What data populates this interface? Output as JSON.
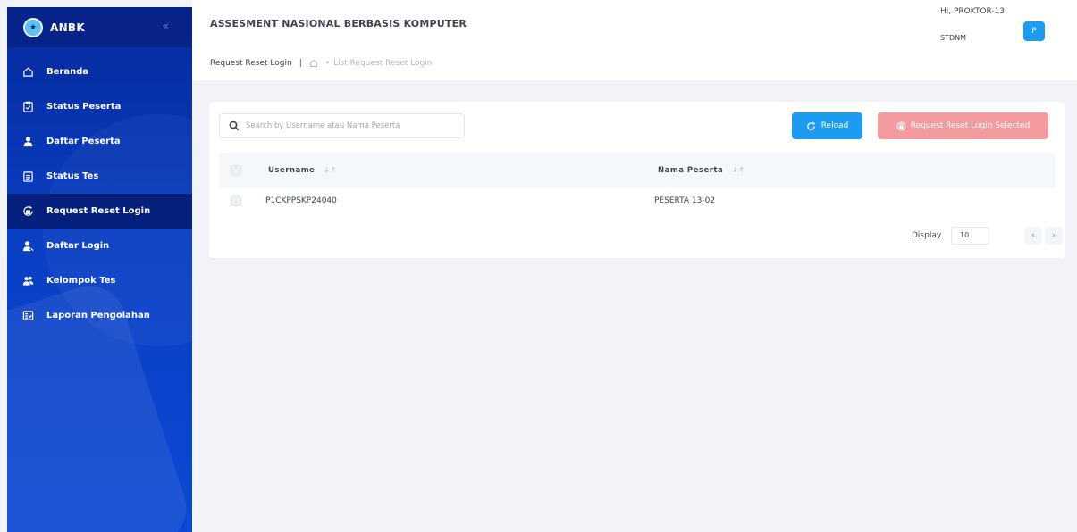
{
  "brand": {
    "name": "ANBK",
    "collapse_icon": "chevrons-left-icon"
  },
  "sidebar": {
    "items": [
      {
        "label": "Beranda",
        "icon": "home-icon",
        "active": false
      },
      {
        "label": "Status Peserta",
        "icon": "clipboard-check-icon",
        "active": false
      },
      {
        "label": "Daftar Peserta",
        "icon": "user-icon",
        "active": false
      },
      {
        "label": "Status Tes",
        "icon": "clipboard-list-icon",
        "active": false
      },
      {
        "label": "Request Reset Login",
        "icon": "reset-lock-icon",
        "active": true
      },
      {
        "label": "Daftar Login",
        "icon": "user-login-icon",
        "active": false
      },
      {
        "label": "Kelompok Tes",
        "icon": "users-group-icon",
        "active": false
      },
      {
        "label": "Laporan Pengolahan",
        "icon": "report-icon",
        "active": false
      }
    ]
  },
  "header": {
    "title": "ASSESMENT NASIONAL BERBASIS KOMPUTER",
    "greeting": "Hi, PROKTOR-13",
    "school": "STDNM",
    "avatar_initial": "P"
  },
  "breadcrumb": {
    "page": "Request Reset Login",
    "separator": "|",
    "dot": "•",
    "current": "List Request Reset Login"
  },
  "toolbar": {
    "search_placeholder": "Search by Username atau Nama Peserta",
    "reload_label": "Reload",
    "request_label": "Request Reset Login Selected"
  },
  "table": {
    "columns": [
      {
        "label": "Username",
        "sort_glyph": "↓↑"
      },
      {
        "label": "Nama Peserta",
        "sort_glyph": "↓↑"
      }
    ],
    "rows": [
      {
        "username": "P1CKPPSKP24040",
        "nama": "PESERTA 13-02"
      }
    ]
  },
  "pagination": {
    "display_label": "Display",
    "display_value": "10",
    "prev": "‹",
    "next": "›"
  },
  "colors": {
    "sidebar": "#0a3fc4",
    "active_item": "#06207e",
    "primary": "#1d9bf0",
    "danger_light": "#f39b9f"
  }
}
